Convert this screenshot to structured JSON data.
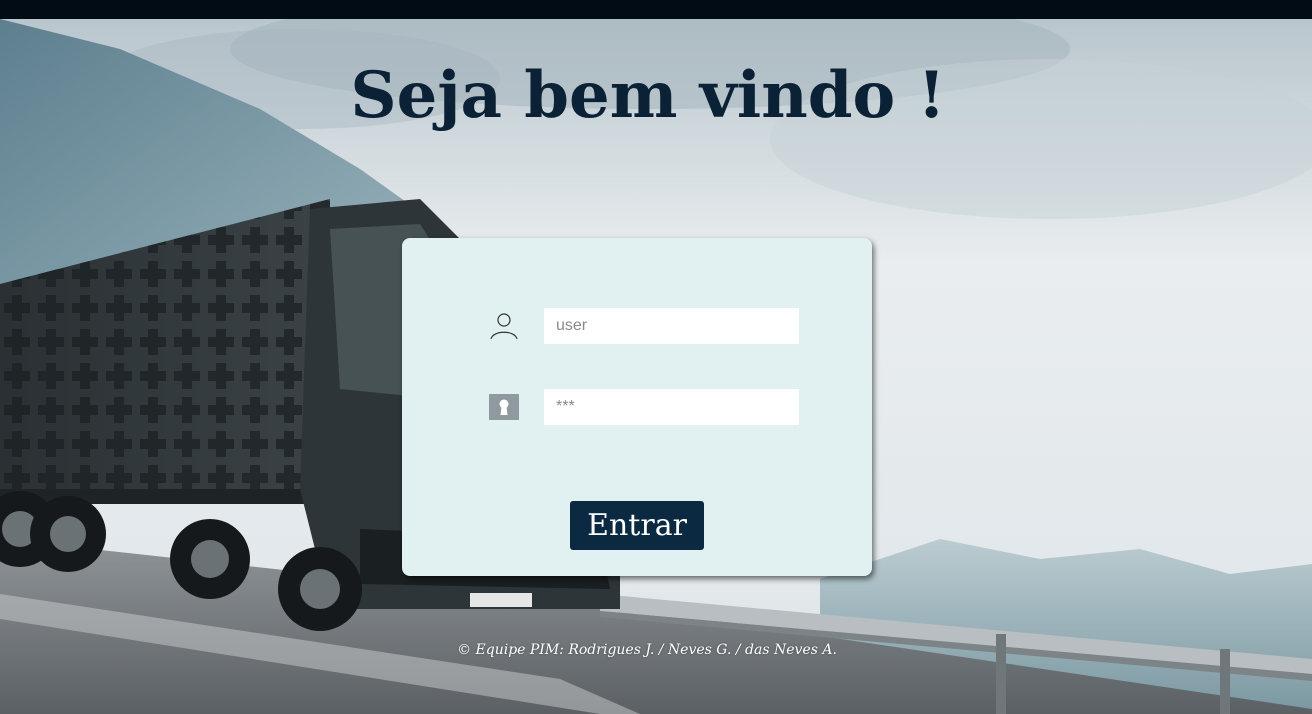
{
  "header": {
    "title": "Seja bem vindo !"
  },
  "login": {
    "user_placeholder": "user",
    "password_placeholder": "***",
    "submit_label": "Entrar",
    "user_icon": "user-icon",
    "password_icon": "keyhole-lock-icon"
  },
  "footer": {
    "credits": "© Equipe PIM: Rodrigues J. / Neves G. / das Neves A."
  },
  "colors": {
    "topbar": "#020c14",
    "title": "#0b2236",
    "card_background": "#e1f1f1",
    "button_background": "#0b2a42",
    "button_text": "#ffffff"
  }
}
